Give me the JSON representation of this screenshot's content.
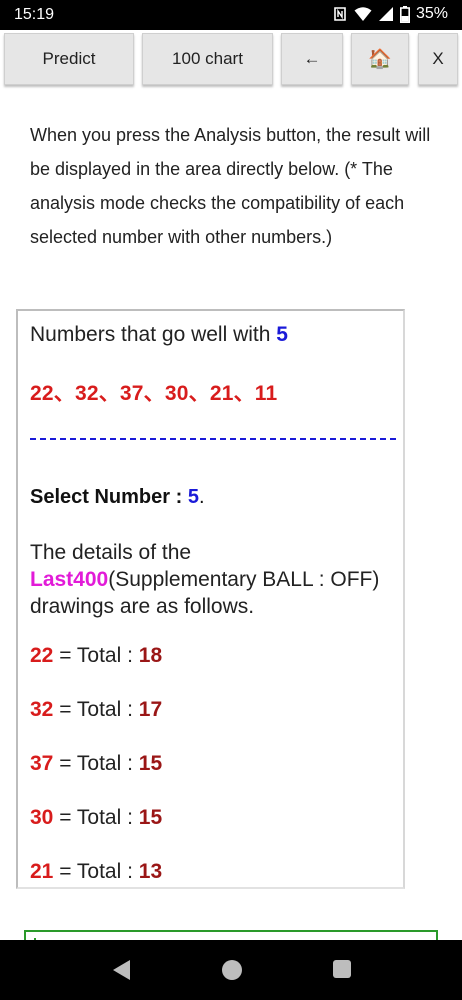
{
  "status": {
    "time": "15:19",
    "battery": "35%"
  },
  "toolbar": {
    "predict": "Predict",
    "chart": "100 chart",
    "back_arrow": "←",
    "home": "🏠",
    "close": "X"
  },
  "intro_text": "When you press the Analysis button, the result will be displayed in the area directly below. (* The analysis mode checks the compatibility of each selected number with other numbers.)",
  "panel": {
    "title_prefix": "Numbers that go well with ",
    "title_number": "5",
    "matches": "22、32、37、30、21、11",
    "select_label": "Select Number : ",
    "select_value": "5",
    "select_suffix": ".",
    "details_prefix": "The details of the ",
    "details_highlight": "Last400",
    "details_suffix": "(Supplementary BALL : OFF) drawings are as follows.",
    "total_label": " = Total : ",
    "rows": [
      {
        "num": "22",
        "total": "18"
      },
      {
        "num": "32",
        "total": "17"
      },
      {
        "num": "37",
        "total": "15"
      },
      {
        "num": "30",
        "total": "15"
      },
      {
        "num": "21",
        "total": "13"
      }
    ]
  },
  "colors": {
    "number_red": "#d81c1c",
    "total_darkred": "#9a1616",
    "selected_blue": "#1a1ad8",
    "highlight_magenta": "#e21bd8"
  },
  "icons": [
    "nfc-icon",
    "wifi-icon",
    "signal-icon",
    "battery-icon",
    "nav-back-icon",
    "nav-home-icon",
    "nav-recent-icon"
  ]
}
